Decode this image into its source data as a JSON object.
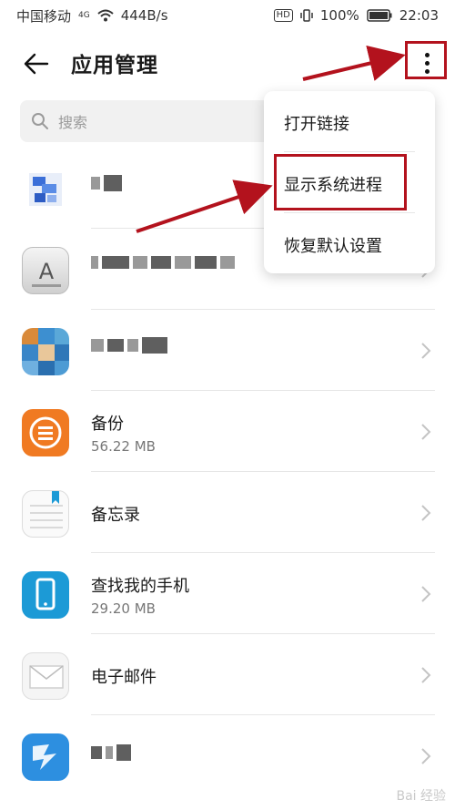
{
  "status_bar": {
    "carrier": "中国移动",
    "network": "4G",
    "speed": "444B/s",
    "hd": "HD",
    "battery": "100%",
    "time": "22:03"
  },
  "header": {
    "title": "应用管理",
    "back_icon": "arrow-left-icon",
    "more_icon": "more-vert-icon"
  },
  "search": {
    "placeholder": "搜索",
    "icon": "search-icon"
  },
  "menu": {
    "items": [
      {
        "label": "打开链接"
      },
      {
        "label": "显示系统进程"
      },
      {
        "label": "恢复默认设置"
      }
    ]
  },
  "apps": [
    {
      "name": "",
      "size": ""
    },
    {
      "name": "",
      "size": ""
    },
    {
      "name": "",
      "size": ""
    },
    {
      "name": "备份",
      "size": "56.22 MB"
    },
    {
      "name": "备忘录",
      "size": ""
    },
    {
      "name": "查找我的手机",
      "size": "29.20 MB"
    },
    {
      "name": "电子邮件",
      "size": ""
    },
    {
      "name": "",
      "size": ""
    }
  ],
  "watermark": "Bai 经验",
  "colors": {
    "highlight": "#b3121d",
    "backup_orange": "#f07a22",
    "find_phone_blue": "#1c9ad6"
  }
}
